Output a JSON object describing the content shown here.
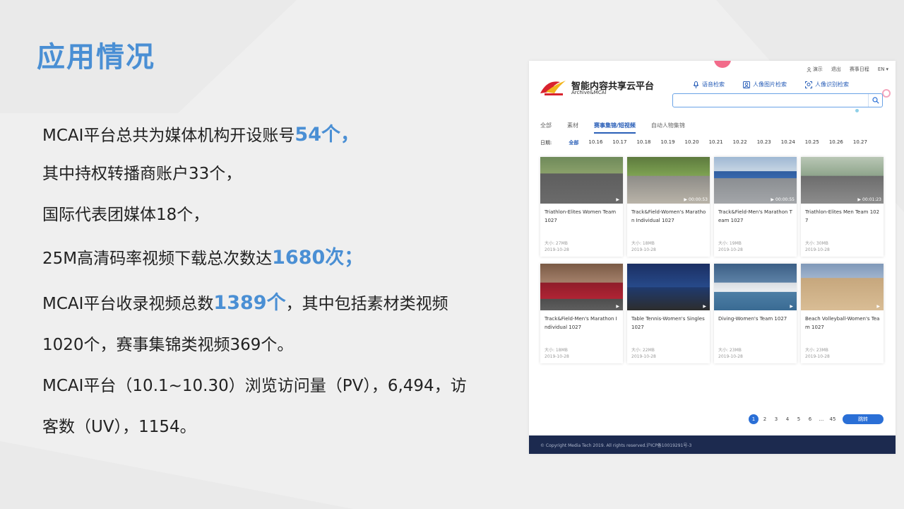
{
  "slide": {
    "title": "应用情况",
    "lines": [
      {
        "pre": "MCAI平台总共为媒体机构开设账号",
        "hl": "54个，",
        "post": ""
      },
      {
        "pre": "其中持权转播商账户33个，",
        "hl": "",
        "post": ""
      },
      {
        "pre": "国际代表团媒体18个，",
        "hl": "",
        "post": ""
      },
      {
        "pre": "25M高清码率视频下载总次数达",
        "hl": "1680次；",
        "post": ""
      },
      {
        "pre": "MCAI平台收录视频总数",
        "hl": "1389个",
        "post": "，其中包括素材类视频"
      },
      {
        "pre": "1020个，赛事集锦类视频369个。",
        "hl": "",
        "post": ""
      },
      {
        "pre": "MCAI平台（10.1~10.30）浏览访问量（PV），6,494，访",
        "hl": "",
        "post": ""
      },
      {
        "pre": "客数（UV），1154。",
        "hl": "",
        "post": ""
      }
    ]
  },
  "app": {
    "top_links": [
      "演示",
      "退出",
      "赛事日程",
      "EN"
    ],
    "brand_title": "智能内容共享云平台",
    "brand_subtitle": "Archive&MCAI",
    "search_modes": [
      "语音检索",
      "人像图片检索",
      "人像识别检索"
    ],
    "search_placeholder": "",
    "tabs": [
      "全部",
      "素材",
      "赛事集锦/短视频",
      "自动人物集锦"
    ],
    "active_tab": 2,
    "date_label": "日期:",
    "dates": [
      "全部",
      "10.16",
      "10.17",
      "10.18",
      "10.19",
      "10.20",
      "10.21",
      "10.22",
      "10.23",
      "10.24",
      "10.25",
      "10.26",
      "10.27"
    ],
    "cards": [
      {
        "title": "Triathlon-Elites Women Team 1027",
        "duration": "",
        "size": "大小: 27MB",
        "date": "2019-10-28",
        "scene": "cycling"
      },
      {
        "title": "Track&Field-Women's Marathon Individual 1027",
        "duration": "00:00:53",
        "size": "大小: 18MB",
        "date": "2019-10-28",
        "scene": "road"
      },
      {
        "title": "Track&Field-Men's Marathon Team 1027",
        "duration": "00:00:55",
        "size": "大小: 19MB",
        "date": "2019-10-28",
        "scene": "finish"
      },
      {
        "title": "Triathlon-Elites Men Team 1027",
        "duration": "00:01:23",
        "size": "大小: 30MB",
        "date": "2019-10-28",
        "scene": "cycling2"
      },
      {
        "title": "Track&Field-Men's Marathon Individual 1027",
        "duration": "",
        "size": "大小: 18MB",
        "date": "2019-10-28",
        "scene": "runner"
      },
      {
        "title": "Table Tennis-Women's Singles 1027",
        "duration": "",
        "size": "大小: 22MB",
        "date": "2019-10-28",
        "scene": "tt"
      },
      {
        "title": "Diving-Women's Team 1027",
        "duration": "",
        "size": "大小: 23MB",
        "date": "2019-10-28",
        "scene": "diving"
      },
      {
        "title": "Beach Volleyball-Women's Team 1027",
        "duration": "",
        "size": "大小: 23MB",
        "date": "2019-10-28",
        "scene": "beach"
      }
    ],
    "pages": [
      "1",
      "2",
      "3",
      "4",
      "5",
      "6",
      "...",
      "45"
    ],
    "active_page": 0,
    "jump_label": "跳转",
    "footer": "© Copyright Media Tech 2019. All rights reserved.沪ICP备10019291号-3"
  },
  "colors": {
    "accent": "#4a8fd4",
    "app_blue": "#2a6fd6",
    "footer_bg": "#1c2a4f"
  }
}
